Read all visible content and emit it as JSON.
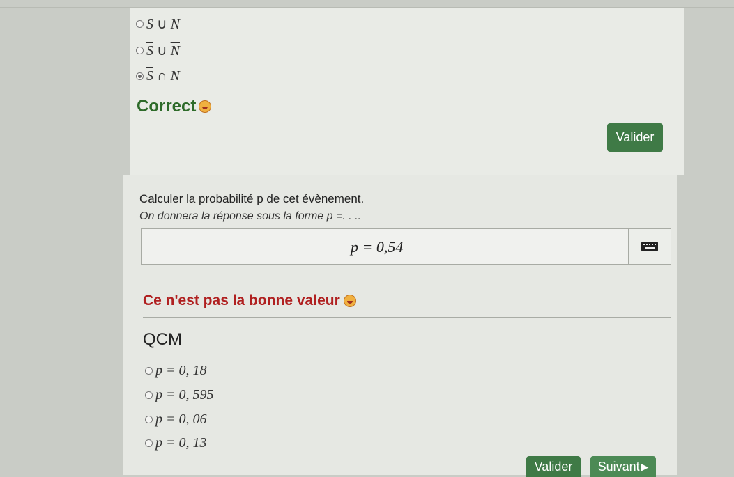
{
  "part1": {
    "options": [
      {
        "parts": [
          "S",
          " ∪ ",
          "N"
        ],
        "overline": [
          false,
          false,
          false
        ],
        "checked": false
      },
      {
        "parts": [
          "S",
          " ∪ ",
          "N"
        ],
        "overline": [
          true,
          false,
          true
        ],
        "checked": false
      },
      {
        "parts": [
          "S",
          " ∩ ",
          "N"
        ],
        "overline": [
          true,
          false,
          false
        ],
        "checked": true
      }
    ],
    "feedback": "Correct",
    "validate_label": "Valider"
  },
  "part2": {
    "question": "Calculer la probabilité p de cet évènement.",
    "hint": "On donnera la réponse sous la forme p =. . ..",
    "answer_value": "p = 0,54",
    "feedback": "Ce n'est pas la bonne valeur"
  },
  "qcm": {
    "title": "QCM",
    "options": [
      "p = 0, 18",
      "p = 0, 595",
      "p = 0, 06",
      "p = 0, 13"
    ],
    "validate_label": "Valider",
    "next_label": "Suivant"
  },
  "colors": {
    "correct": "#2e6b2a",
    "wrong": "#b02020",
    "button": "#3f7a46"
  },
  "icons": [
    "smiley-icon",
    "keyboard-icon",
    "play-arrow-icon"
  ]
}
